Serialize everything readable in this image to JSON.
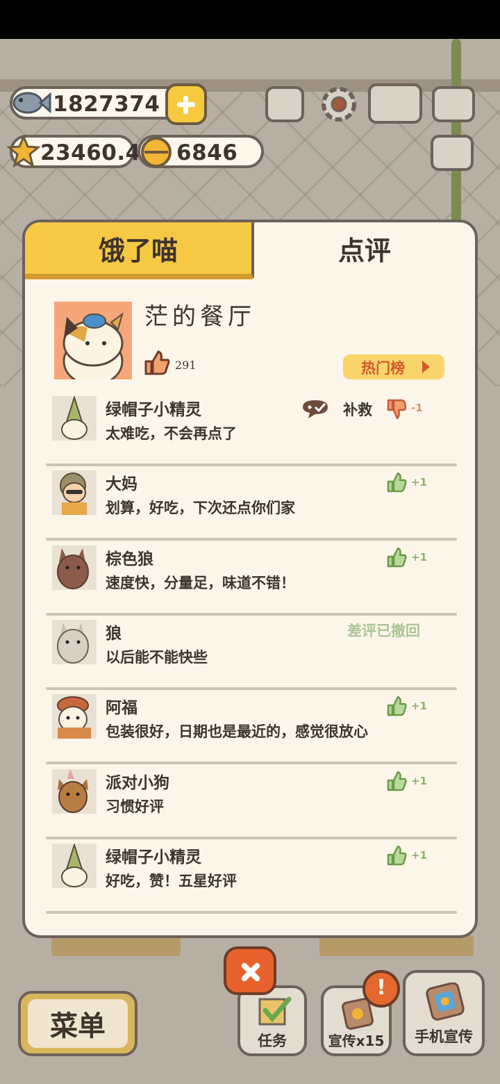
{
  "currency": {
    "fish": "1827374",
    "stars": "23460.4",
    "bells": "6846"
  },
  "tabs": {
    "hungry_cat": "饿了喵",
    "reviews": "点评"
  },
  "restaurant": {
    "name": "茫的餐厅",
    "likes": "291",
    "hot_list_label": "热门榜"
  },
  "reviews": [
    {
      "name": "绿帽子小精灵",
      "text": "太难吃，不会再点了",
      "type": "negative",
      "action": "补救",
      "vote": "-1"
    },
    {
      "name": "大妈",
      "text": "划算，好吃，下次还点你们家",
      "type": "positive",
      "vote": "+1"
    },
    {
      "name": "棕色狼",
      "text": "速度快，分量足，味道不错！",
      "type": "positive",
      "vote": "+1"
    },
    {
      "name": "狼",
      "text": "以后能不能快些",
      "type": "retracted",
      "status": "差评已撤回"
    },
    {
      "name": "阿福",
      "text": "包装很好，日期也是最近的，感觉很放心",
      "type": "positive",
      "vote": "+1"
    },
    {
      "name": "派对小狗",
      "text": "习惯好评",
      "type": "positive",
      "vote": "+1"
    },
    {
      "name": "绿帽子小精灵",
      "text": "好吃，赞！五星好评",
      "type": "positive",
      "vote": "+1"
    }
  ],
  "bottom": {
    "menu": "菜单",
    "tasks": "任务",
    "promote": "宣传x15",
    "alert": "!",
    "phone_promote": "手机宣传"
  },
  "colors": {
    "tab_active": "#f7c843",
    "panel": "#fcf6ea",
    "positive": "#8ab46a",
    "negative": "#e08f6b",
    "close": "#e9612c"
  }
}
